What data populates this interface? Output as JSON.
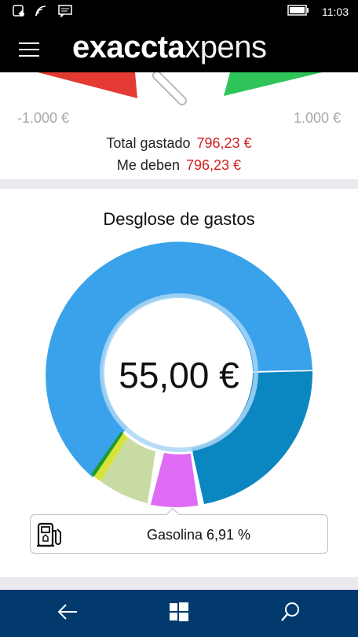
{
  "status": {
    "time": "11:03"
  },
  "header": {
    "logo_bold": "exaccta",
    "logo_light": "xpens"
  },
  "gauge": {
    "min_label": "-1.000 €",
    "max_label": "1.000 €"
  },
  "totals": {
    "spent_label": "Total gastado",
    "spent_value": "796,23 €",
    "owed_label": "Me deben",
    "owed_value": "796,23 €"
  },
  "breakdown": {
    "title": "Desglose de gastos",
    "center_value": "55,00 €",
    "selected": {
      "label": "Gasolina 6,91 %",
      "icon": "fuel-pump-icon"
    },
    "colors": [
      "#3aa2ea",
      "#0a86c0",
      "#e06cf6",
      "#c9dba4",
      "#d7e437",
      "#1e9b2b"
    ]
  },
  "icons": [
    "signal-icon",
    "wifi-icon",
    "message-icon",
    "battery-icon",
    "menu-icon",
    "back-icon",
    "windows-icon",
    "search-icon",
    "fuel-pump-icon"
  ]
}
